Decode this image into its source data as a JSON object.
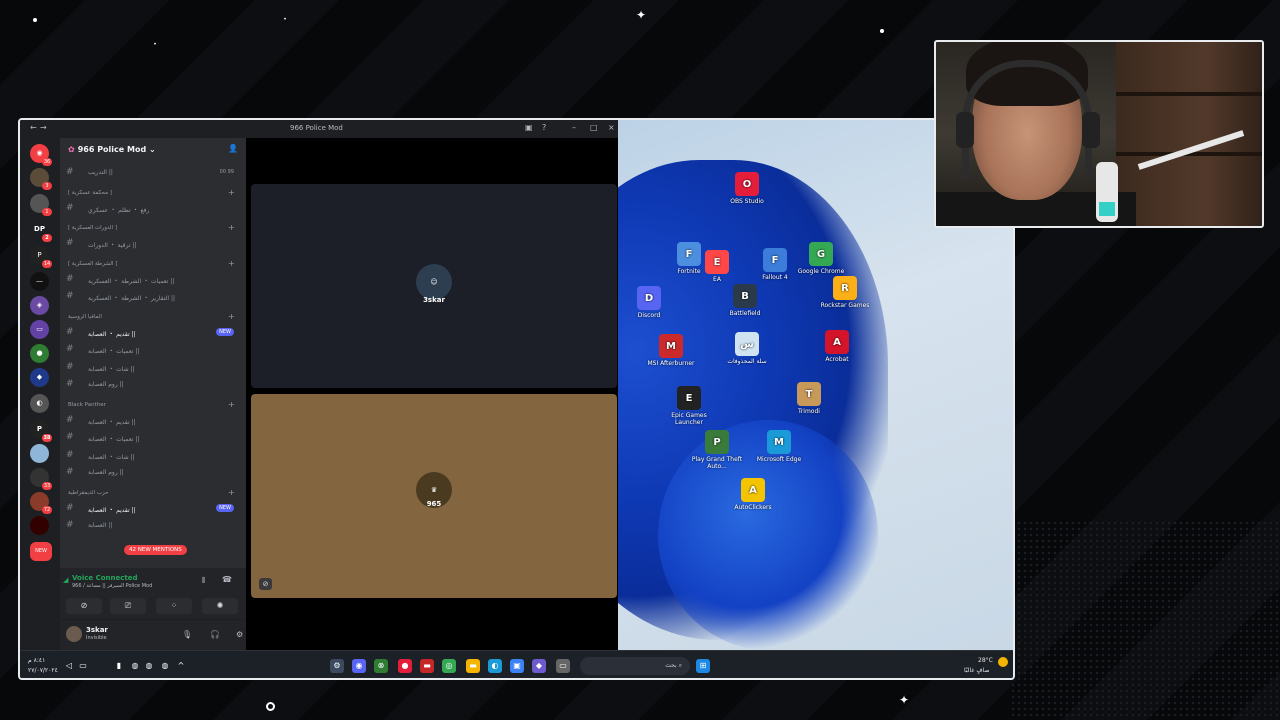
{
  "window": {
    "title": "966 Police Mod"
  },
  "server": {
    "name": "966 Police Mod"
  },
  "guild_badges": [
    "36",
    "3",
    "1",
    "2",
    "14",
    "38",
    "33",
    "72",
    "NEW"
  ],
  "channels": [
    {
      "type": "channel",
      "name": "التدريب ||",
      "extra": "00 99"
    },
    {
      "type": "category",
      "name": "[ محكمة عسكرية ]"
    },
    {
      "type": "channel",
      "name": "رفع ・ تظلم ・ عسكري"
    },
    {
      "type": "category",
      "name": "[ الدورات العسكرية ]"
    },
    {
      "type": "channel",
      "name": "ترقية ・ الدورات ||"
    },
    {
      "type": "category",
      "name": "[ الشرطة العسكرية ]"
    },
    {
      "type": "channel",
      "name": "تعميات ・ الشرطة ・ العسكرية ||"
    },
    {
      "type": "channel",
      "name": "التقارير ・ الشرطة ・ العسكرية ||"
    },
    {
      "type": "category",
      "name": "المافيا الروسية"
    },
    {
      "type": "channel",
      "name": "تقديم ・ العصابة ||",
      "new": "NEW"
    },
    {
      "type": "channel",
      "name": "تعميات ・ العصابة ||"
    },
    {
      "type": "channel",
      "name": "شات ・ العصابة ||"
    },
    {
      "type": "channel",
      "name": "روم العصابة ||"
    },
    {
      "type": "category",
      "name": "Black Panther"
    },
    {
      "type": "channel",
      "name": "تقديم ・ العصابة ||"
    },
    {
      "type": "channel",
      "name": "تعميات ・ العصابة ||"
    },
    {
      "type": "channel",
      "name": "شات ・ العصابة ||"
    },
    {
      "type": "channel",
      "name": "روم العصابة ||"
    },
    {
      "type": "category",
      "name": "حزب الديمقراطية"
    },
    {
      "type": "channel",
      "name": "تقديم ・ العصابة ||",
      "new": "NEW"
    },
    {
      "type": "channel",
      "name": "العصابة ||"
    }
  ],
  "mentions_pill": "42 NEW MENTIONS",
  "voice": {
    "status": "Voice Connected",
    "channel": "966 / السيرفر || مساعد Police Mod"
  },
  "user": {
    "name": "3skar",
    "status": "Invisible"
  },
  "stage": {
    "tile1_label": "3skar",
    "tile2_label": "965"
  },
  "desktop_icons": [
    {
      "label": "OBS Studio",
      "icon": "obs-icon",
      "color": "#e41e3a"
    },
    {
      "label": "Fortnite",
      "icon": "fortnite-icon",
      "color": "#4b8fde"
    },
    {
      "label": "EA",
      "icon": "ea-icon",
      "color": "#ff4747"
    },
    {
      "label": "Fallout 4",
      "icon": "fallout-icon",
      "color": "#3b7dd8"
    },
    {
      "label": "Google Chrome",
      "icon": "chrome-icon",
      "color": "#34a853"
    },
    {
      "label": "Discord",
      "icon": "discord-icon",
      "color": "#5865f2"
    },
    {
      "label": "Battlefield",
      "icon": "battlefield-icon",
      "color": "#2b3a4a"
    },
    {
      "label": "Rockstar Games",
      "icon": "rockstar-icon",
      "color": "#fcaf17"
    },
    {
      "label": "MSI Afterburner",
      "icon": "msi-icon",
      "color": "#cc2a2a"
    },
    {
      "label": "سلة المحذوفات",
      "icon": "recycle-bin-icon",
      "color": "#cfe3f0"
    },
    {
      "label": "Acrobat",
      "icon": "acrobat-icon",
      "color": "#d4142a"
    },
    {
      "label": "Epic Games Launcher",
      "icon": "epic-icon",
      "color": "#222222"
    },
    {
      "label": "Trimodi",
      "icon": "app-icon",
      "color": "#c89a5a"
    },
    {
      "label": "Play Grand Theft Auto...",
      "icon": "gta-icon",
      "color": "#3a7a3a"
    },
    {
      "label": "Microsoft Edge",
      "icon": "edge-icon",
      "color": "#1a9bd7"
    },
    {
      "label": "AutoClickers",
      "icon": "autoclicker-icon",
      "color": "#f5c400"
    }
  ],
  "taskbar": {
    "search_placeholder": "بحث",
    "weather_temp": "28°C",
    "weather_desc": "صافٍ غالبًا",
    "time": "٨:٤١ م",
    "date": "٢٧/٠٧/٢٠٢٤"
  }
}
